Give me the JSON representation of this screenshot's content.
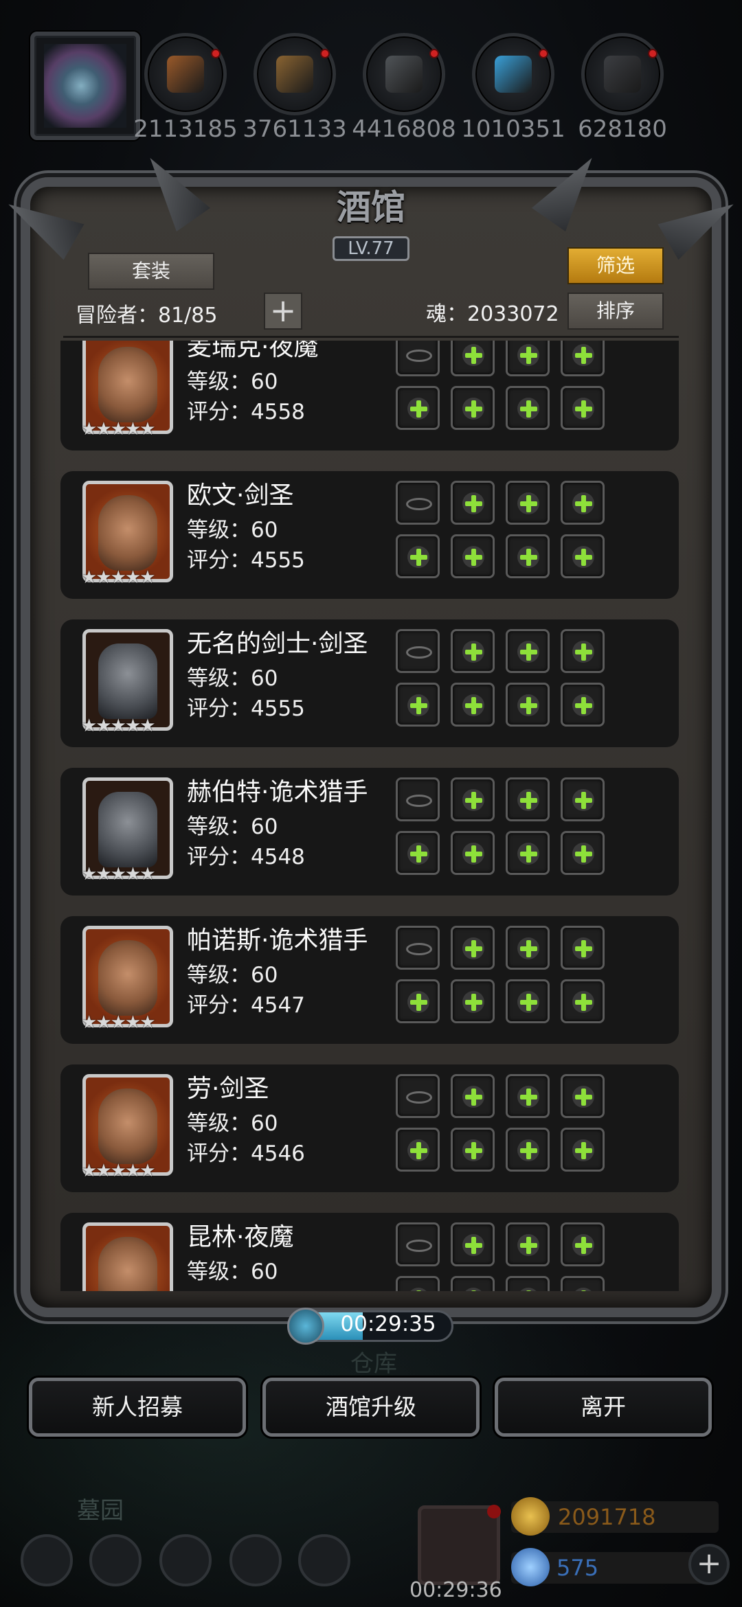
{
  "resources": [
    {
      "name": "meat",
      "value": "2113185",
      "color": "#9a5a2a"
    },
    {
      "name": "wood",
      "value": "3761133",
      "color": "#8a6432"
    },
    {
      "name": "iron",
      "value": "4416808",
      "color": "#505458"
    },
    {
      "name": "crystal",
      "value": "1010351",
      "color": "#3aa0d8"
    },
    {
      "name": "stone",
      "value": "628180",
      "color": "#3c3e42"
    }
  ],
  "panel": {
    "title": "酒馆",
    "level": "LV.77",
    "set_button": "套装",
    "filter_button": "筛选",
    "sort_button": "排序",
    "adventurers_label": "冒险者：81/85",
    "add_icon": "+",
    "soul_label": "魂：2033072"
  },
  "heroes": [
    {
      "name": "麦瑞克·夜魔",
      "level": "等级：60",
      "score": "评分：4558",
      "stars": "★★★★★",
      "portrait": "eyepatch"
    },
    {
      "name": "欧文·剑圣",
      "level": "等级：60",
      "score": "评分：4555",
      "stars": "★★★★★",
      "portrait": "beard"
    },
    {
      "name": "无名的剑士·剑圣",
      "level": "等级：60",
      "score": "评分：4555",
      "stars": "★★★★★",
      "portrait": "helm"
    },
    {
      "name": "赫伯特·诡术猎手",
      "level": "等级：60",
      "score": "评分：4548",
      "stars": "★★★★★",
      "portrait": "helm"
    },
    {
      "name": "帕诺斯·诡术猎手",
      "level": "等级：60",
      "score": "评分：4547",
      "stars": "★★★★★",
      "portrait": "eyepatch"
    },
    {
      "name": "劳·剑圣",
      "level": "等级：60",
      "score": "评分：4546",
      "stars": "★★★★★",
      "portrait": "beard"
    },
    {
      "name": "昆林·夜魔",
      "level": "等级：60",
      "score": "",
      "stars": "",
      "portrait": "eyepatch"
    }
  ],
  "timer": {
    "text": "00:29:35",
    "progress": 0.45
  },
  "bottom_buttons": {
    "recruit": "新人招募",
    "upgrade": "酒馆升级",
    "leave": "离开"
  },
  "background_labels": {
    "warehouse": "仓库",
    "graveyard": "墓园"
  },
  "gift_timer": "00:29:36",
  "currency": {
    "gold": "2091718",
    "gems": "575"
  },
  "accent": {
    "gold": "#d49a22",
    "green": "#8ee03a",
    "gold_text": "#8a5a1a",
    "gem_text": "#3a6fb8"
  }
}
